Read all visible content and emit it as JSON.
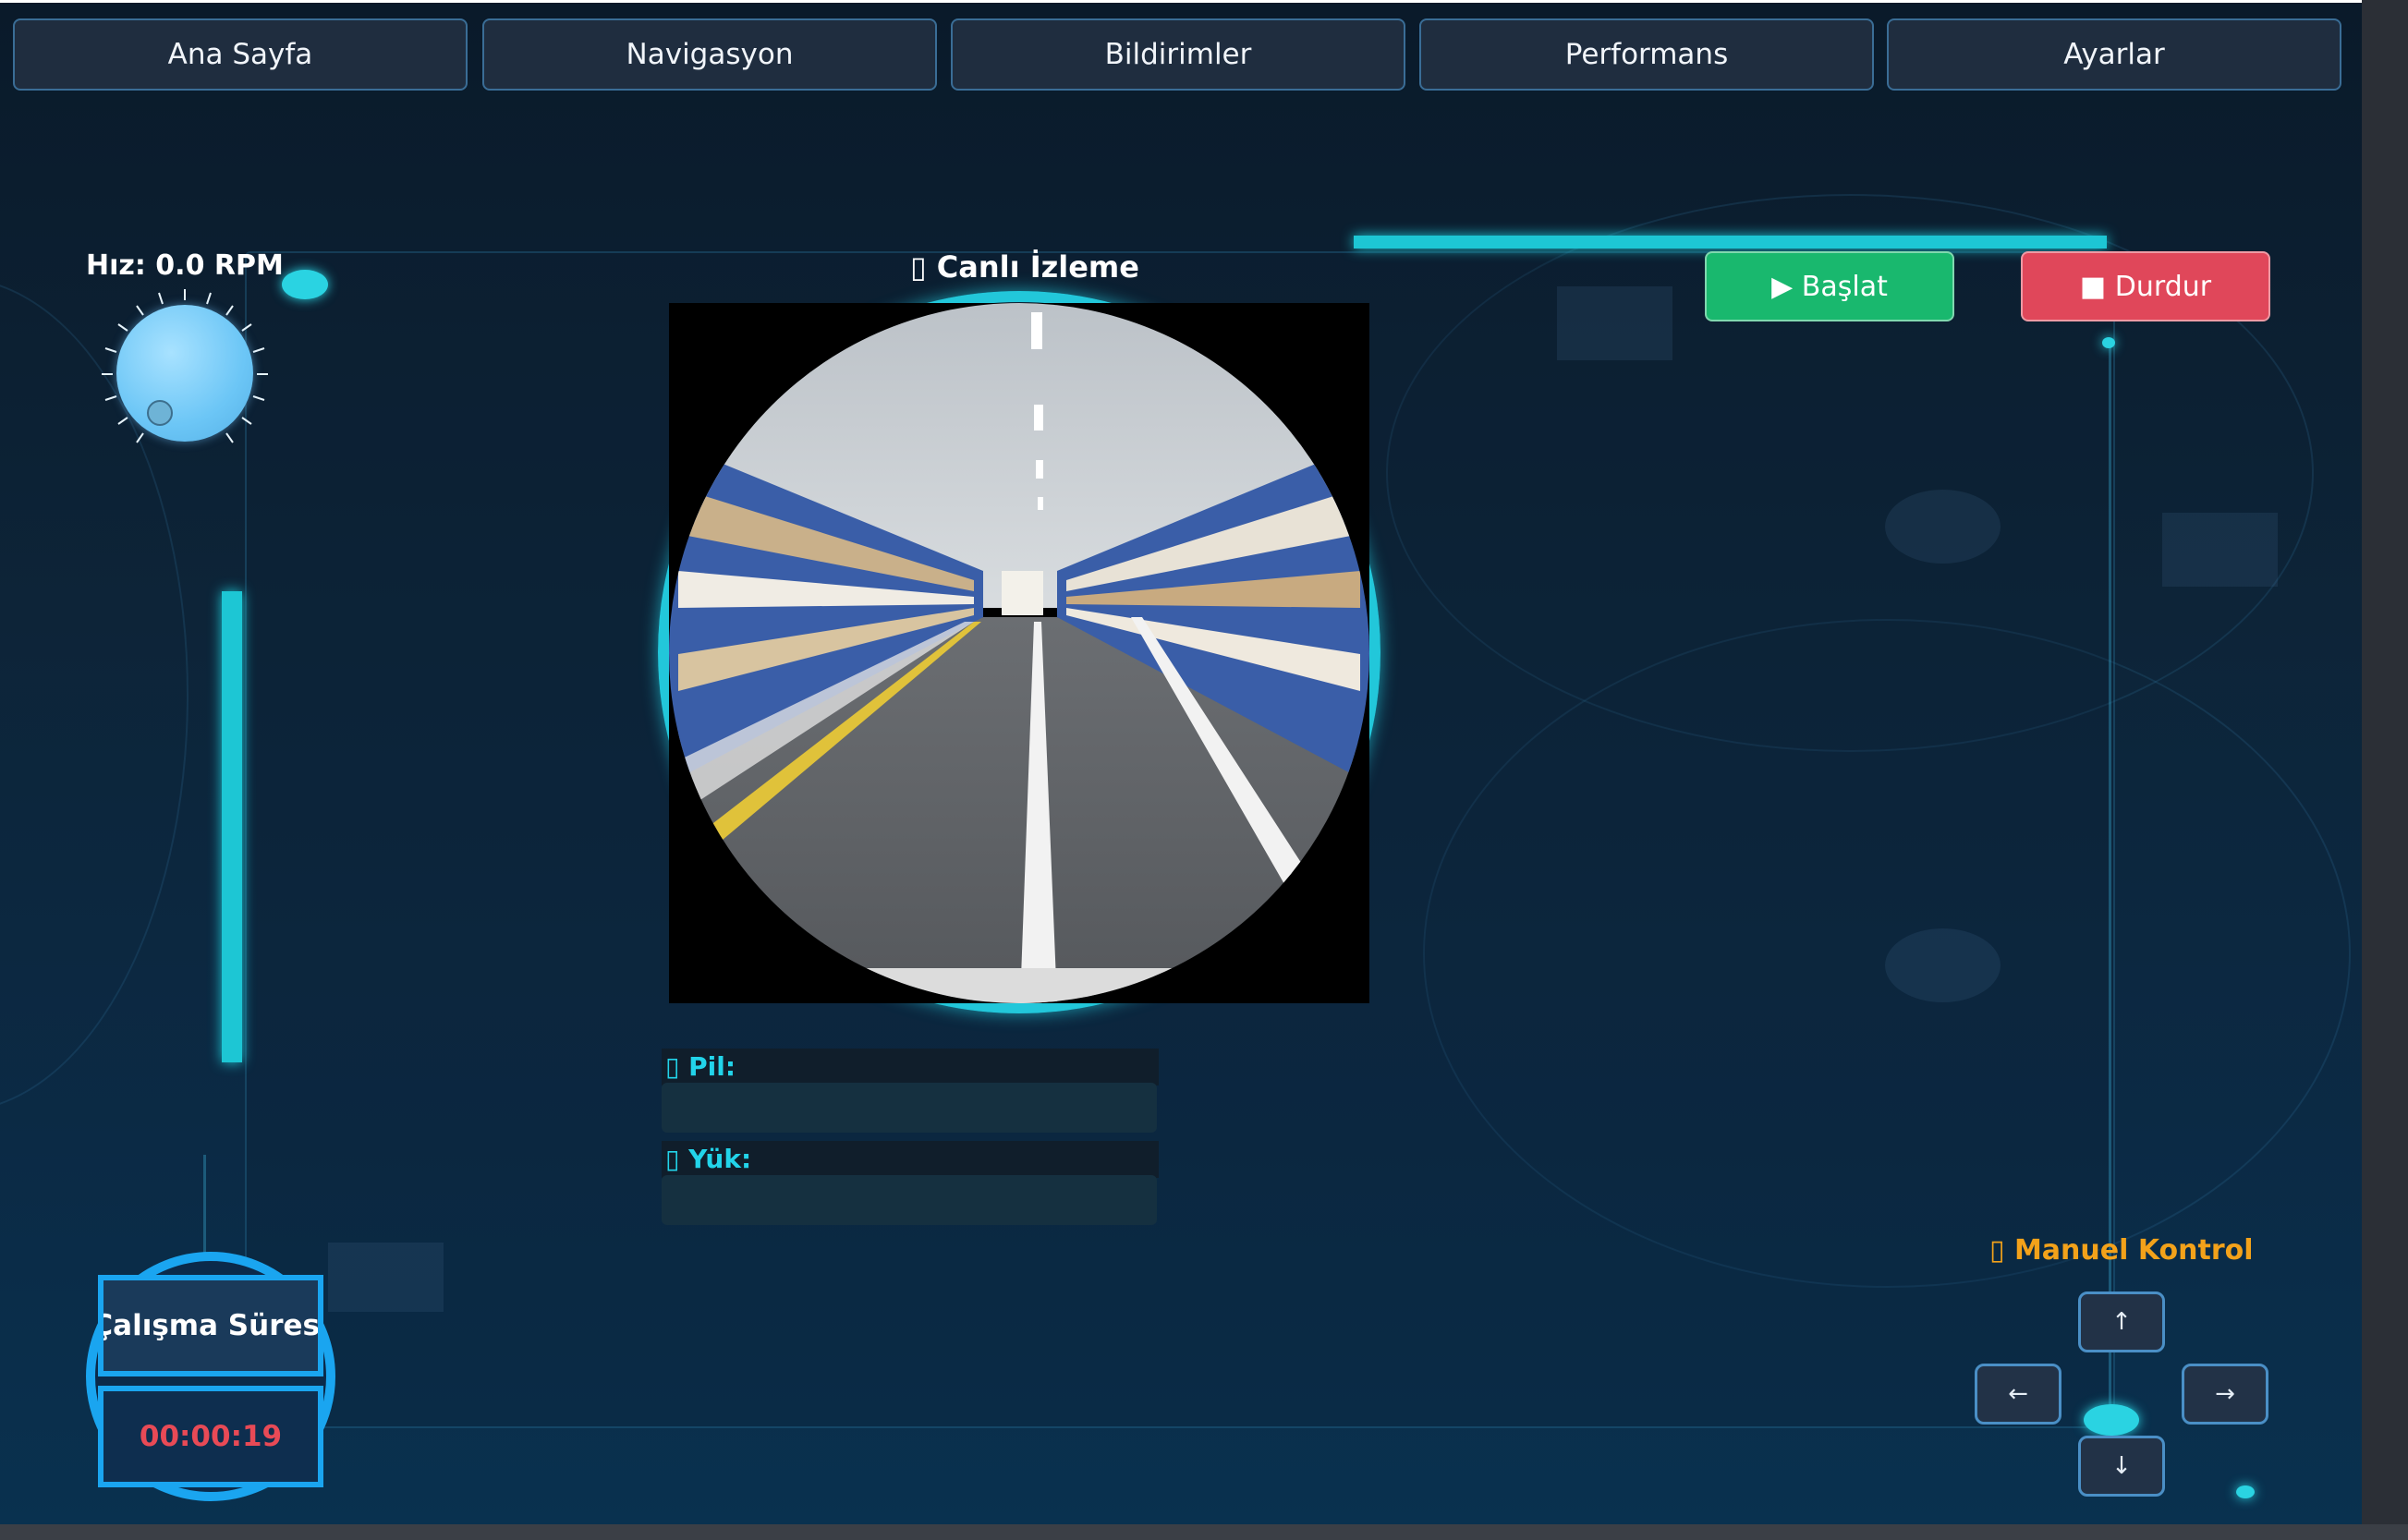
{
  "nav": {
    "tabs": [
      {
        "label": "Ana Sayfa"
      },
      {
        "label": "Navigasyon"
      },
      {
        "label": "Bildirimler"
      },
      {
        "label": "Performans"
      },
      {
        "label": "Ayarlar"
      }
    ]
  },
  "speed": {
    "label": "Hız: 0.0 RPM"
  },
  "live": {
    "title": "▯ Canlı İzleme"
  },
  "status": {
    "battery_label": "▯ Pil:",
    "load_label": "▯ Yük:"
  },
  "controls": {
    "start_label": "▶ Başlat",
    "stop_label": "■ Durdur"
  },
  "manual": {
    "title": "▯ Manuel Kontrol",
    "up": "↑",
    "left": "←",
    "right": "→",
    "down": "↓"
  },
  "timer": {
    "label": "Çalışma Süresi",
    "value": "00:00:19"
  },
  "colors": {
    "accent": "#22c7da",
    "start": "#19b86e",
    "stop": "#e0475a",
    "manual_title": "#f3a21a",
    "timer_value": "#e84a56"
  }
}
